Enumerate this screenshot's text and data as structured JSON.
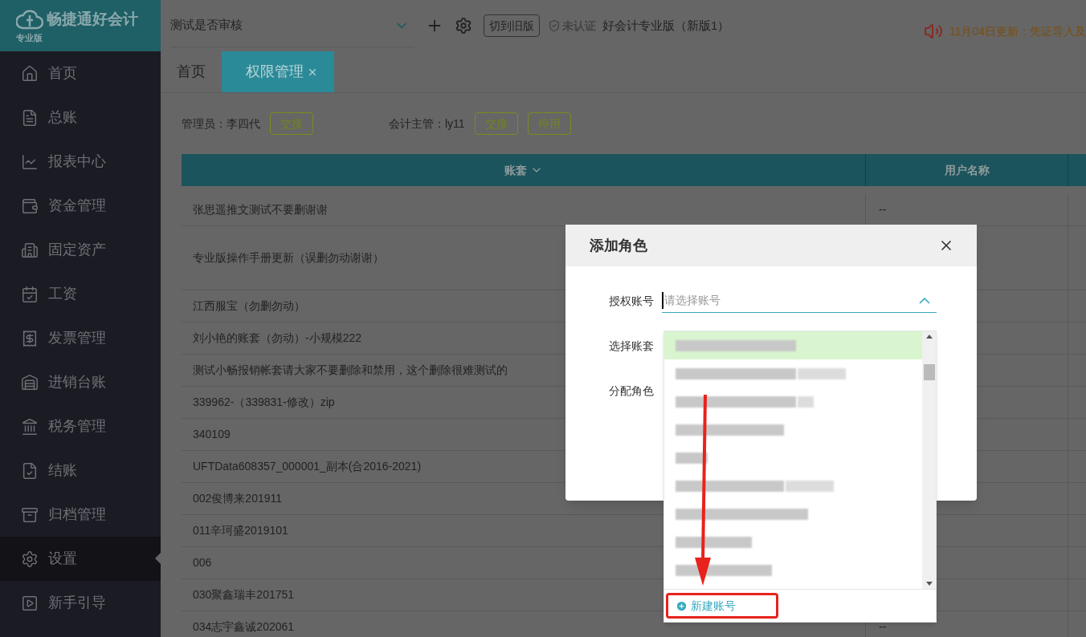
{
  "logo": {
    "name": "畅捷通好会计",
    "edition": "专业版"
  },
  "sidebar": {
    "items": [
      {
        "label": "首页",
        "selected": false
      },
      {
        "label": "总账",
        "selected": false
      },
      {
        "label": "报表中心",
        "selected": false
      },
      {
        "label": "资金管理",
        "selected": false
      },
      {
        "label": "固定资产",
        "selected": false
      },
      {
        "label": "工资",
        "selected": false
      },
      {
        "label": "发票管理",
        "selected": false
      },
      {
        "label": "进销台账",
        "selected": false
      },
      {
        "label": "税务管理",
        "selected": false
      },
      {
        "label": "结账",
        "selected": false
      },
      {
        "label": "归档管理",
        "selected": false
      },
      {
        "label": "设置",
        "selected": true
      },
      {
        "label": "新手引导",
        "selected": false
      }
    ]
  },
  "topbar": {
    "account_set": "测试是否审核",
    "switch_button": "切到旧版",
    "certification": "未认证",
    "product": "好会计专业版（新版1）",
    "notice": "11月04日更新：凭证导入及"
  },
  "tabs": [
    {
      "label": "首页",
      "selected": false,
      "closable": false
    },
    {
      "label": "权限管理",
      "selected": true,
      "closable": true
    }
  ],
  "admins": [
    {
      "label": "管理员：李四代",
      "buttons": [
        "交接"
      ]
    },
    {
      "label": "会计主管：ly11",
      "buttons": [
        "交接",
        "停用"
      ]
    }
  ],
  "table": {
    "columns": [
      "账套",
      "用户名称"
    ],
    "rows": [
      {
        "cells": [
          "张思遥推文测试不要删谢谢",
          "--"
        ]
      },
      {
        "cells": [
          "专业版操作手册更新（误删勿动谢谢）",
          ""
        ]
      },
      {
        "cells": [
          "江西服宝（勿删勿动）",
          ""
        ]
      },
      {
        "cells": [
          "刘小艳的账套（勿动）-小规模222",
          ""
        ]
      },
      {
        "cells": [
          "测试小畅报销帐套请大家不要删除和禁用，这个删除很难测试的",
          ""
        ]
      },
      {
        "cells": [
          "339962-（339831-修改）zip",
          ""
        ]
      },
      {
        "cells": [
          "340109",
          ""
        ]
      },
      {
        "cells": [
          "UFTData608357_000001_副本(合2016-2021)",
          ""
        ]
      },
      {
        "cells": [
          "002俊博来201911",
          ""
        ]
      },
      {
        "cells": [
          "011辛珂盛2019101",
          ""
        ]
      },
      {
        "cells": [
          "006",
          ""
        ]
      },
      {
        "cells": [
          "030聚鑫瑞丰201751",
          ""
        ]
      },
      {
        "cells": [
          "034志宇鑫诚202061",
          "--"
        ]
      }
    ]
  },
  "dialog": {
    "title": "添加角色",
    "fields": [
      {
        "label": "授权账号",
        "placeholder": "请选择账号",
        "expanded": true
      },
      {
        "label": "选择账套"
      },
      {
        "label": "分配角色"
      }
    ],
    "dropdown": {
      "items": [
        {
          "selected": true
        },
        {
          "selected": false
        },
        {
          "selected": false
        },
        {
          "selected": false
        },
        {
          "selected": false
        },
        {
          "selected": false
        },
        {
          "selected": false
        },
        {
          "selected": false
        },
        {
          "selected": false
        }
      ],
      "footer": "新建账号"
    }
  }
}
